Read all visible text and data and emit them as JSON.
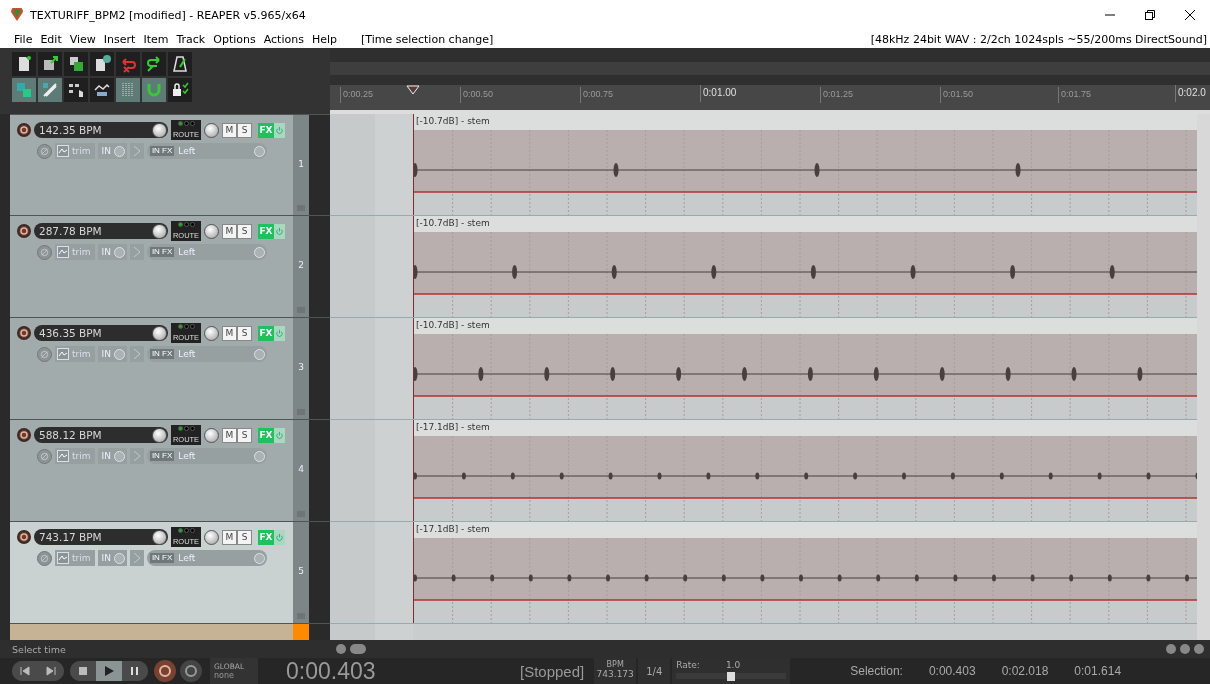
{
  "window": {
    "title": "TEXTURIFF_BPM2 [modified] - REAPER v5.965/x64"
  },
  "menu": [
    "File",
    "Edit",
    "View",
    "Insert",
    "Item",
    "Track",
    "Options",
    "Actions",
    "Help"
  ],
  "undo_status": "[Time selection change]",
  "audio_status": "[48kHz 24bit WAV : 2/2ch 1024spls ~55/200ms DirectSound]",
  "ruler": [
    {
      "label": "0:00.25",
      "major": false
    },
    {
      "label": "0:00.50",
      "major": false
    },
    {
      "label": "0:00.75",
      "major": false
    },
    {
      "label": "0:01.00",
      "major": true
    },
    {
      "label": "0:01.25",
      "major": false
    },
    {
      "label": "0:01.50",
      "major": false
    },
    {
      "label": "0:01.75",
      "major": false
    },
    {
      "label": "0:02.0",
      "major": true
    }
  ],
  "tracks": [
    {
      "kind": "full",
      "name": "142.35 BPM",
      "number": "1",
      "selected": false,
      "route": "ROUTE",
      "mute": "M",
      "solo": "S",
      "fx": "FX",
      "trim": "trim",
      "input": "IN",
      "input_fx": "IN FX",
      "channel": "Left",
      "item": "[-10.7dB] - stem"
    },
    {
      "kind": "full",
      "name": "287.78 BPM",
      "number": "2",
      "selected": false,
      "route": "ROUTE",
      "mute": "M",
      "solo": "S",
      "fx": "FX",
      "trim": "trim",
      "input": "IN",
      "input_fx": "IN FX",
      "channel": "Left",
      "item": "[-10.7dB] - stem"
    },
    {
      "kind": "full",
      "name": "436.35 BPM",
      "number": "3",
      "selected": false,
      "route": "ROUTE",
      "mute": "M",
      "solo": "S",
      "fx": "FX",
      "trim": "trim",
      "input": "IN",
      "input_fx": "IN FX",
      "channel": "Left",
      "item": "[-10.7dB] - stem"
    },
    {
      "kind": "full",
      "name": "588.12 BPM",
      "number": "4",
      "selected": false,
      "route": "ROUTE",
      "mute": "M",
      "solo": "S",
      "fx": "FX",
      "trim": "trim",
      "input": "IN",
      "input_fx": "IN FX",
      "channel": "Left",
      "item": "[-17.1dB] - stem"
    },
    {
      "kind": "full",
      "name": "743.17 BPM",
      "number": "5",
      "selected": true,
      "route": "ROUTE",
      "mute": "M",
      "solo": "S",
      "fx": "FX",
      "trim": "trim",
      "input": "IN",
      "input_fx": "IN FX",
      "channel": "Left",
      "item": "[-17.1dB] - stem"
    },
    {
      "kind": "partial",
      "color": "#ff8a00"
    }
  ],
  "status_text": "Select time",
  "transport": {
    "automation_mode": "GLOBAL",
    "automation_value": "none",
    "time": "0:00.403",
    "state": "[Stopped]",
    "bpm_label": "BPM",
    "bpm": "743.173",
    "signature": "1/4",
    "rate_label": "Rate:",
    "rate": "1.0",
    "rate_slider": {
      "level": 0.5
    },
    "selection_label": "Selection:",
    "selection_start": "0:00.403",
    "selection_end": "0:02.018",
    "selection_length": "0:01.614"
  }
}
